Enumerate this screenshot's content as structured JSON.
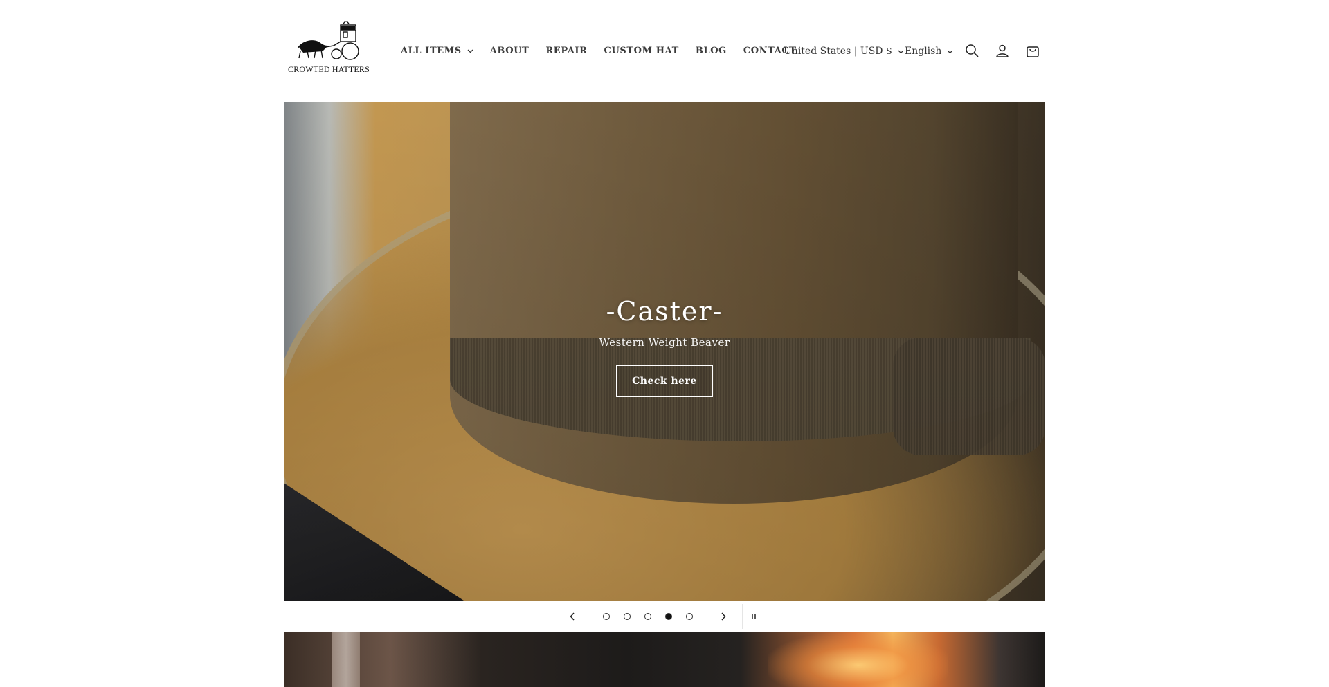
{
  "header": {
    "logo_text": "CROWTED HATTERS",
    "nav": [
      {
        "label": "ALL ITEMS",
        "has_dropdown": true
      },
      {
        "label": "ABOUT",
        "has_dropdown": false
      },
      {
        "label": "REPAIR",
        "has_dropdown": false
      },
      {
        "label": "CUSTOM HAT",
        "has_dropdown": false
      },
      {
        "label": "BLOG",
        "has_dropdown": false
      },
      {
        "label": "CONTACT",
        "has_dropdown": false
      }
    ],
    "country_selector": "United States | USD $",
    "language_selector": "English",
    "icons": [
      "search-icon",
      "account-icon",
      "cart-icon"
    ]
  },
  "hero": {
    "title": "-Caster-",
    "subtitle": "Western Weight Beaver",
    "button_label": "Check here"
  },
  "slider": {
    "slide_count": 5,
    "active_index": 3,
    "controls": [
      "prev-arrow-icon",
      "next-arrow-icon",
      "pause-icon"
    ]
  },
  "colors": {
    "text": "#333333",
    "border": "#e8e8e8",
    "active_dot": "#111111"
  }
}
